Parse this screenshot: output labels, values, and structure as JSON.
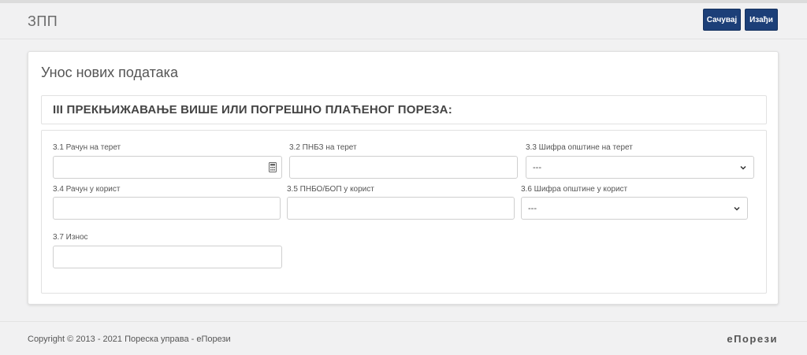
{
  "header": {
    "app_title": "ЗПП",
    "save_label": "Сачувај",
    "exit_label": "Изађи"
  },
  "card": {
    "title": "Унос нових података",
    "section_title": "III ПРЕКЊИЖАВАЊЕ ВИШЕ ИЛИ ПОГРЕШНО ПЛАЋЕНОГ ПОРЕЗА:"
  },
  "fields": {
    "f31": {
      "label": "3.1 Рачун на терет",
      "value": ""
    },
    "f32": {
      "label": "3.2 ПНБЗ на терет",
      "value": ""
    },
    "f33": {
      "label": "3.3 Шифра општине на терет",
      "value": "---"
    },
    "f34": {
      "label": "3.4 Рачун у корист",
      "value": ""
    },
    "f35": {
      "label": "3.5 ПНБО/БОП у корист",
      "value": ""
    },
    "f36": {
      "label": "3.6 Шифра општине у корист",
      "value": "---"
    },
    "f37": {
      "label": "3.7 Износ",
      "value": ""
    }
  },
  "footer": {
    "copyright": "Copyright © 2013 - 2021 Пореска управа - еПорези",
    "brand": "еПорези"
  },
  "icons": {
    "calculator": "calculator-icon",
    "chevron": "chevron-down-icon"
  },
  "colors": {
    "primary_button": "#1c3f78",
    "background": "#f1f1f2"
  }
}
